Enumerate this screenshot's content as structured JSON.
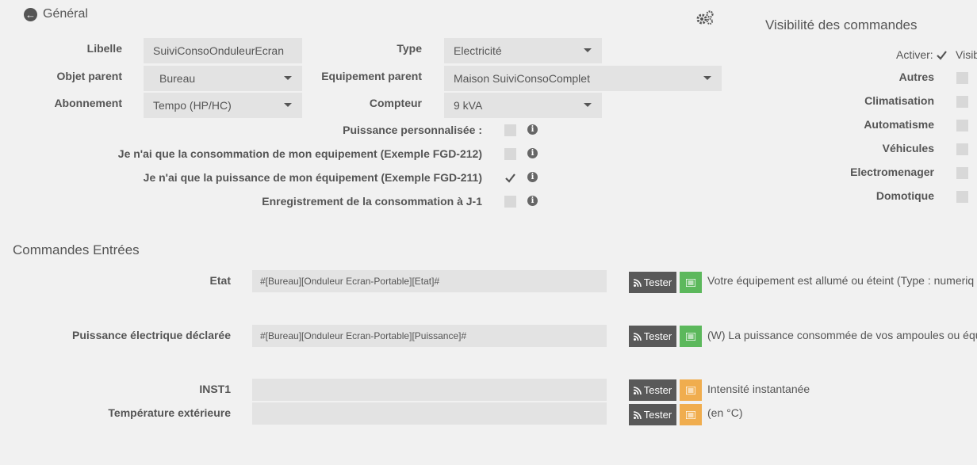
{
  "header": {
    "back_label": "Général",
    "back_icon": "arrow-left-circle",
    "config_icon": "gears"
  },
  "general": {
    "libelle_label": "Libelle",
    "libelle_value": "SuiviConsoOnduleurEcran",
    "type_label": "Type",
    "type_value": "Electricité",
    "objet_label": "Objet parent",
    "objet_value": "Bureau",
    "equip_label": "Equipement parent",
    "equip_value": "Maison SuiviConsoComplet",
    "abo_label": "Abonnement",
    "abo_value": "Tempo (HP/HC)",
    "compteur_label": "Compteur",
    "compteur_value": "9 kVA"
  },
  "options": [
    {
      "label": "Puissance personnalisée :",
      "checked": false
    },
    {
      "label": "Je n'ai que la consommation de mon equipement (Exemple FGD-212)",
      "checked": false
    },
    {
      "label": "Je n'ai que la puissance de mon équipement (Exemple FGD-211)",
      "checked": true
    },
    {
      "label": "Enregistrement de la consommation à J-1",
      "checked": false
    }
  ],
  "visibility": {
    "title": "Visibilité des commandes",
    "activer_label": "Activer:",
    "visible_label": "Visib",
    "categories": [
      "Autres",
      "Climatisation",
      "Automatisme",
      "Véhicules",
      "Electromenager",
      "Domotique"
    ]
  },
  "commands": {
    "title": "Commandes Entrées",
    "tester_label": "Tester",
    "items": [
      {
        "label": "Etat",
        "value": "#[Bureau][Onduleur Ecran-Portable][Etat]#",
        "description": "Votre équipement est allumé ou éteint (Type : numeriq",
        "button_color": "green"
      },
      {
        "label": "Puissance électrique déclarée",
        "value": "#[Bureau][Onduleur Ecran-Portable][Puissance]#",
        "description": "(W) La puissance consommée de vos ampoules ou équ",
        "button_color": "green"
      },
      {
        "label": "INST1",
        "value": "",
        "description": "Intensité instantanée",
        "button_color": "orange"
      },
      {
        "label": "Température extérieure",
        "value": "",
        "description": "(en °C)",
        "button_color": "orange"
      }
    ]
  },
  "colors": {
    "background": "#f1f1f1",
    "field": "#e3e3e3",
    "tester": "#595959",
    "green": "#5cb85c",
    "orange": "#f0ad4e"
  }
}
